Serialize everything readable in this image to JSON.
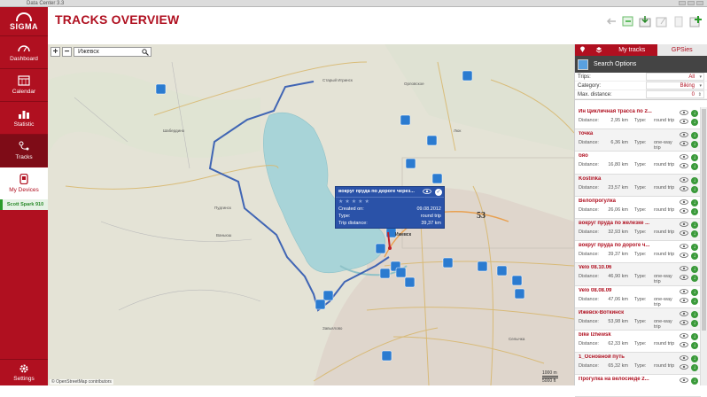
{
  "window": {
    "title": "Data Center 3.3"
  },
  "brand": {
    "name": "SIGMA",
    "accent": "#b01020"
  },
  "sidebar": {
    "items": [
      {
        "label": "Dashboard",
        "icon": "dashboard-icon"
      },
      {
        "label": "Calendar",
        "icon": "calendar-icon"
      },
      {
        "label": "Statistic",
        "icon": "statistic-icon"
      },
      {
        "label": "Tracks",
        "icon": "tracks-icon"
      },
      {
        "label": "My Devices",
        "icon": "device-icon"
      }
    ],
    "device": "Scott Spark 910",
    "settings": "Settings"
  },
  "header": {
    "title": "TRACKS OVERVIEW"
  },
  "map": {
    "search_value": "Ижевск",
    "attribution": "© OpenStreetMap contributors",
    "scale_top": "1000 m",
    "scale_bottom": "5000 ft",
    "road_number": "53",
    "places": [
      "Старый Игринск",
      "Орловское",
      "Люк",
      "Шабердино",
      "Пудгинск",
      "Ваньюш",
      "Ижевск",
      "Завьялово",
      "Селычка"
    ],
    "popup": {
      "title": "вокруг пруда по дороге через...",
      "created_label": "Created on:",
      "created_value": "09.08.2012",
      "type_label": "Type:",
      "type_value": "round trip",
      "distance_label": "Trip distance:",
      "distance_value": "39,37 km"
    }
  },
  "panel": {
    "tabs": [
      "My tracks",
      "GPSies"
    ],
    "search_options": "Search Options",
    "filters": [
      {
        "label": "Trips:",
        "value": "All"
      },
      {
        "label": "Category:",
        "value": "Biking"
      },
      {
        "label": "Max. distance:",
        "value": "0"
      }
    ],
    "distance_label": "Distance:",
    "type_label": "Type:",
    "tracks": [
      {
        "name": "Ин Цикличная трасса по 2...",
        "distance": "2,95 km",
        "type": "round trip"
      },
      {
        "name": "точка",
        "distance": "6,36 km",
        "type": "one-way trip"
      },
      {
        "name": "бяо",
        "distance": "16,80 km",
        "type": "round trip"
      },
      {
        "name": "Kostinka",
        "distance": "23,57 km",
        "type": "round trip"
      },
      {
        "name": "Велопрогулка",
        "distance": "26,06 km",
        "type": "round trip"
      },
      {
        "name": "вокруг пруда по железке ...",
        "distance": "32,93 km",
        "type": "round trip"
      },
      {
        "name": "вокруг пруда по дороге ч...",
        "distance": "39,37 km",
        "type": "round trip"
      },
      {
        "name": "Velo 08.10.06",
        "distance": "46,90 km",
        "type": "one-way trip"
      },
      {
        "name": "Velo 08.08.09",
        "distance": "47,06 km",
        "type": "one-way trip"
      },
      {
        "name": "Ижевск-Воткинск",
        "distance": "53,98 km",
        "type": "one-way trip"
      },
      {
        "name": "bike Izhewsk",
        "distance": "62,33 km",
        "type": "round trip"
      },
      {
        "name": "1_Основной путь",
        "distance": "65,32 km",
        "type": "round trip"
      },
      {
        "name": "Прогулка на велосиеде 2...",
        "distance": "",
        "type": ""
      }
    ]
  }
}
